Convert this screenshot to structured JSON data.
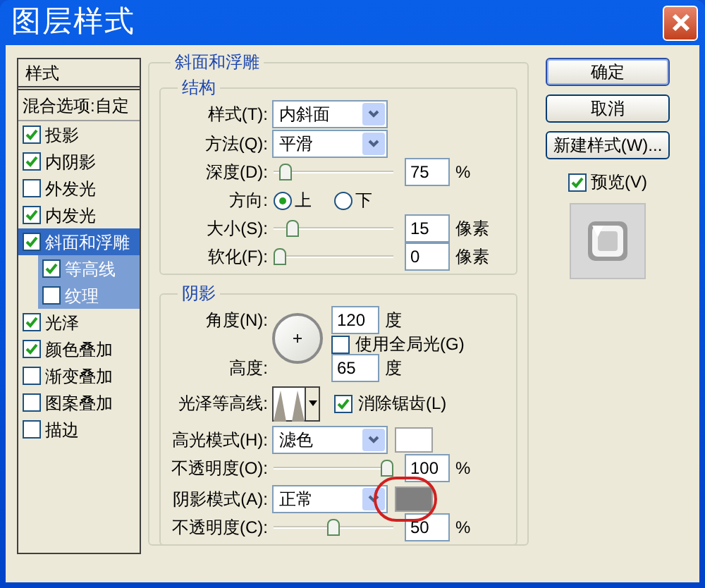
{
  "window": {
    "title": "图层样式"
  },
  "styles_list": {
    "header": "样式",
    "blend_options": "混合选项:自定",
    "items": [
      {
        "label": "投影",
        "checked": true,
        "selected": false
      },
      {
        "label": "内阴影",
        "checked": true,
        "selected": false
      },
      {
        "label": "外发光",
        "checked": false,
        "selected": false
      },
      {
        "label": "内发光",
        "checked": true,
        "selected": false
      },
      {
        "label": "斜面和浮雕",
        "checked": true,
        "selected": true,
        "children": [
          {
            "label": "等高线",
            "checked": true,
            "selected": false
          },
          {
            "label": "纹理",
            "checked": false,
            "selected": false
          }
        ]
      },
      {
        "label": "光泽",
        "checked": true,
        "selected": false
      },
      {
        "label": "颜色叠加",
        "checked": true,
        "selected": false
      },
      {
        "label": "渐变叠加",
        "checked": false,
        "selected": false
      },
      {
        "label": "图案叠加",
        "checked": false,
        "selected": false
      },
      {
        "label": "描边",
        "checked": false,
        "selected": false
      }
    ]
  },
  "bevel": {
    "title": "斜面和浮雕",
    "structure": {
      "title": "结构",
      "style": {
        "label": "样式(T):",
        "value": "内斜面"
      },
      "technique": {
        "label": "方法(Q):",
        "value": "平滑"
      },
      "depth": {
        "label": "深度(D):",
        "level": 0.05,
        "value": "75",
        "unit": "%"
      },
      "direction": {
        "label": "方向:",
        "options": [
          {
            "label": "上",
            "selected": true
          },
          {
            "label": "下",
            "selected": false
          }
        ]
      },
      "size": {
        "label": "大小(S):",
        "level": 0.12,
        "value": "15",
        "unit": "像素"
      },
      "soften": {
        "label": "软化(F):",
        "level": 0,
        "value": "0",
        "unit": "像素"
      }
    },
    "shading": {
      "title": "阴影",
      "angle": {
        "label": "角度(N):",
        "value": "120",
        "unit": "度"
      },
      "use_global_light": {
        "label": "使用全局光(G)",
        "checked": false
      },
      "altitude": {
        "label": "高度:",
        "value": "65",
        "unit": "度"
      },
      "gloss_contour": {
        "label": "光泽等高线:"
      },
      "anti_aliased": {
        "label": "消除锯齿(L)",
        "checked": true
      },
      "highlight_mode": {
        "label": "高光模式(H):",
        "value": "滤色",
        "color": "#ffffff"
      },
      "highlight_opacity": {
        "label": "不透明度(O):",
        "level": 1,
        "value": "100",
        "unit": "%"
      },
      "shadow_mode": {
        "label": "阴影模式(A):",
        "value": "正常",
        "color": "#808080"
      },
      "shadow_opacity": {
        "label": "不透明度(C):",
        "level": 0.5,
        "value": "50",
        "unit": "%"
      }
    }
  },
  "buttons": [
    {
      "label": "确定",
      "default": true
    },
    {
      "label": "取消",
      "default": false
    },
    {
      "label": "新建样式(W)...",
      "default": false
    }
  ],
  "preview": {
    "label": "预览(V)",
    "checked": true
  }
}
